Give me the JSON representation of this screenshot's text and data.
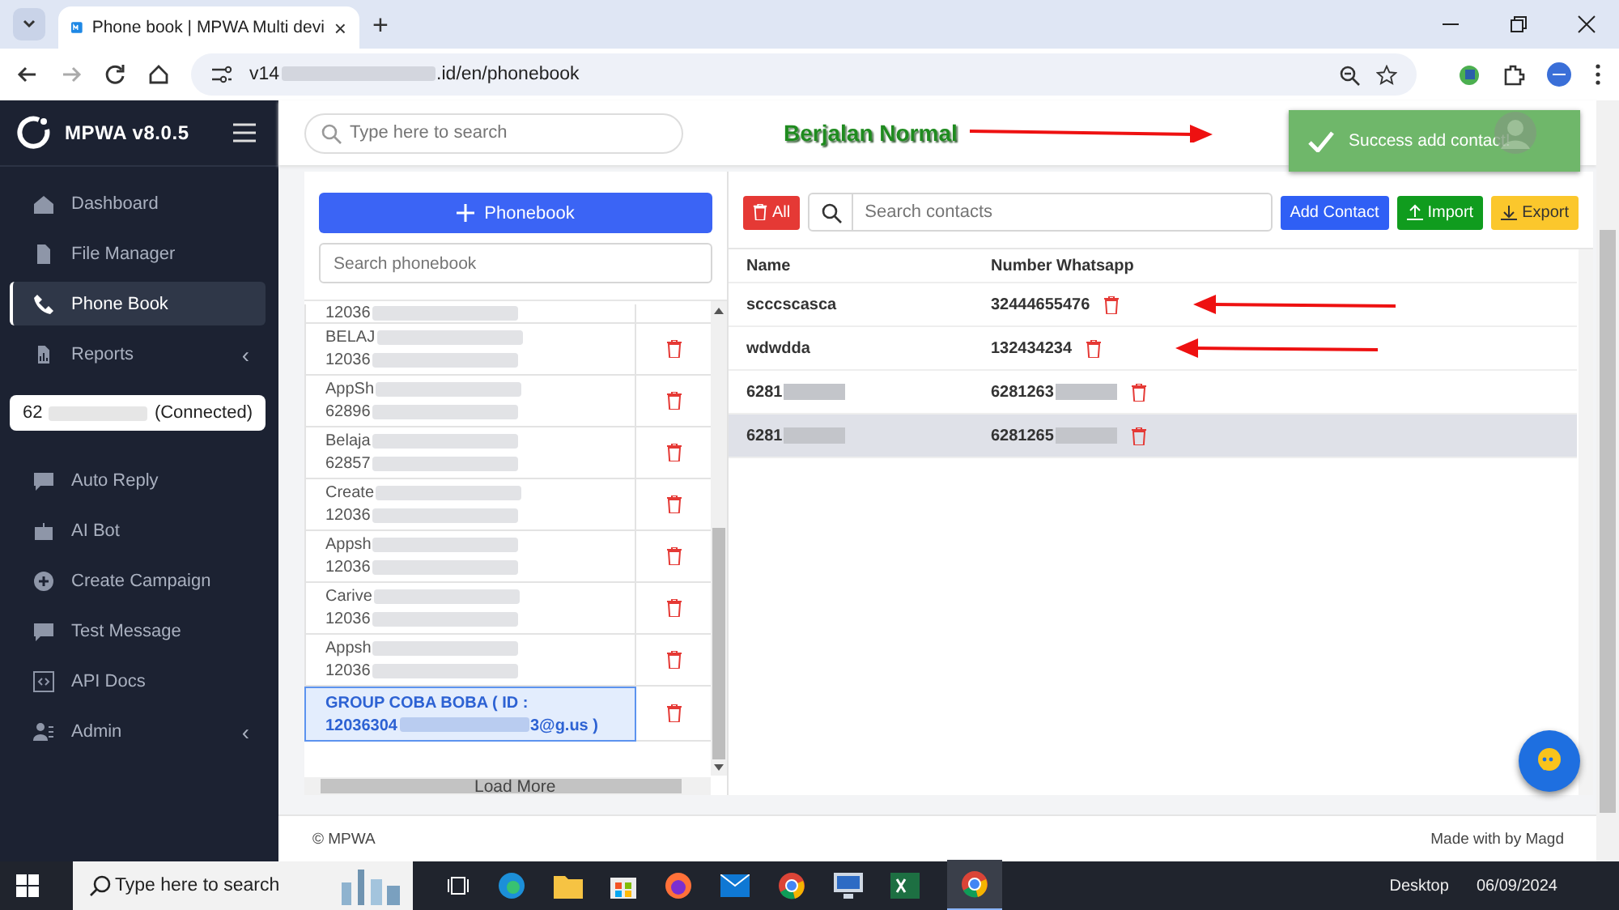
{
  "browser": {
    "tab_title": "Phone book | MPWA Multi devi",
    "tab_close": "×",
    "new_tab": "+",
    "url_start": "v14",
    "url_end": ".id/en/phonebook"
  },
  "sidebar": {
    "brand": "MPWA v8.0.5",
    "items": [
      {
        "label": "Dashboard",
        "selected": false
      },
      {
        "label": "File Manager",
        "selected": false
      },
      {
        "label": "Phone Book",
        "selected": true
      },
      {
        "label": "Reports",
        "selected": false,
        "caret": "‹"
      }
    ],
    "device": {
      "number": "62",
      "status": "(Connected)"
    },
    "items2": [
      {
        "label": "Auto Reply",
        "selected": false
      },
      {
        "label": "AI Bot",
        "selected": false
      },
      {
        "label": "Create Campaign",
        "selected": false
      },
      {
        "label": "Test Message",
        "selected": false
      },
      {
        "label": "API Docs",
        "selected": false
      },
      {
        "label": "Admin",
        "selected": false,
        "caret": "‹"
      }
    ]
  },
  "topbar": {
    "search_placeholder": "Type here to search",
    "annotation": "Berjalan Normal",
    "toast": "Success add contact!"
  },
  "phonebook": {
    "add_button": "Phonebook",
    "search_placeholder": "Search phonebook",
    "load_more": "Load More",
    "items": [
      {
        "number": "12036",
        "selected": false
      },
      {
        "name": "BELAJ",
        "number": "12036",
        "selected": false
      },
      {
        "name": "AppSh",
        "number": "62896",
        "selected": false
      },
      {
        "name": "Belaja",
        "number": "62857",
        "selected": false
      },
      {
        "name": "Create",
        "number": "12036",
        "selected": false
      },
      {
        "name": "Appsh",
        "number": "12036",
        "selected": false
      },
      {
        "name": "Carive",
        "number": "12036",
        "selected": false
      },
      {
        "name": "Appsh",
        "number": "12036",
        "selected": false
      },
      {
        "name": "GROUP COBA BOBA ( ID :",
        "number": "12036304",
        "number_end": "3@g.us )",
        "selected": true
      }
    ]
  },
  "contacts": {
    "delete_all": "All",
    "search_placeholder": "Search contacts",
    "add": "Add Contact",
    "import": "Import",
    "export": "Export",
    "columns": [
      "Name",
      "Number Whatsapp"
    ],
    "rows": [
      {
        "name": "scccscasca",
        "number": "32444655476",
        "selected": false,
        "arrow": true,
        "redacted": false
      },
      {
        "name": "wdwdda",
        "number": "132434234",
        "selected": false,
        "arrow": true,
        "redacted": false
      },
      {
        "name": "6281",
        "number": "6281263",
        "selected": false,
        "arrow": false,
        "redacted": true
      },
      {
        "name": "6281",
        "number": "6281265",
        "selected": true,
        "arrow": false,
        "redacted": true
      }
    ]
  },
  "footer": {
    "copyright": "© MPWA",
    "credit": "Made with by Magd"
  },
  "taskbar": {
    "search_placeholder": "Type here to search",
    "desktop": "Desktop",
    "date": "06/09/2024"
  }
}
